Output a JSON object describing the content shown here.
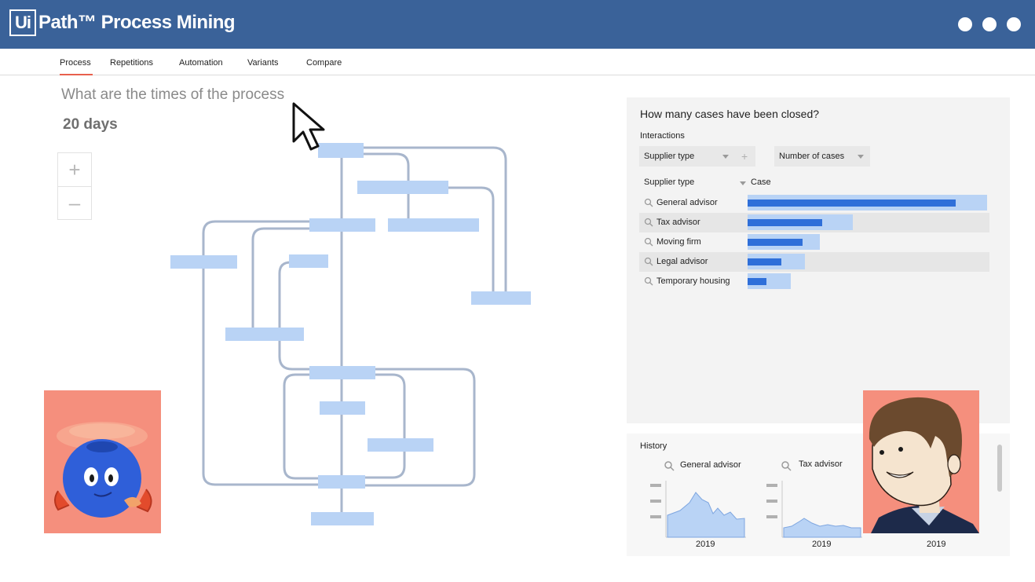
{
  "app": {
    "logo_mark": "Ui",
    "title": "Path™ Process Mining",
    "window_controls": [
      "dot",
      "dot",
      "dot"
    ]
  },
  "tabs": [
    {
      "label": "Process",
      "active": true
    },
    {
      "label": "Repetitions",
      "active": false
    },
    {
      "label": "Automation",
      "active": false
    },
    {
      "label": "Variants",
      "active": false
    },
    {
      "label": "Compare",
      "active": false
    }
  ],
  "process": {
    "question": "What are the times of the process",
    "duration": "20 days",
    "zoom_in_icon": "plus-icon",
    "zoom_out_icon": "minus-icon"
  },
  "cases_panel": {
    "title": "How many cases have been closed?",
    "interactions_label": "Interactions",
    "dropdown_dimension": "Supplier type",
    "dropdown_measure": "Number of cases",
    "column_dimension": "Supplier type",
    "column_measure": "Case",
    "rows": [
      {
        "label": "General advisor",
        "value": 0.87,
        "total": 1.0
      },
      {
        "label": "Tax advisor",
        "value": 0.31,
        "total": 0.44
      },
      {
        "label": "Moving firm",
        "value": 0.23,
        "total": 0.3
      },
      {
        "label": "Legal advisor",
        "value": 0.14,
        "total": 0.24
      },
      {
        "label": "Temporary housing",
        "value": 0.08,
        "total": 0.18
      }
    ]
  },
  "history": {
    "label": "History",
    "charts": [
      {
        "title": "General advisor",
        "year": "2019"
      },
      {
        "title": "Tax advisor",
        "year": "2019"
      },
      {
        "title": "",
        "year": "2019"
      }
    ]
  },
  "colors": {
    "header": "#3a6299",
    "accent": "#e8604c",
    "bar": "#2f6fd9",
    "bar_light": "#b9d3f5",
    "node": "#b9d3f5",
    "edge": "#a8b6cc",
    "avatar_bg": "#f58f7d",
    "robot": "#2f5fd9"
  }
}
